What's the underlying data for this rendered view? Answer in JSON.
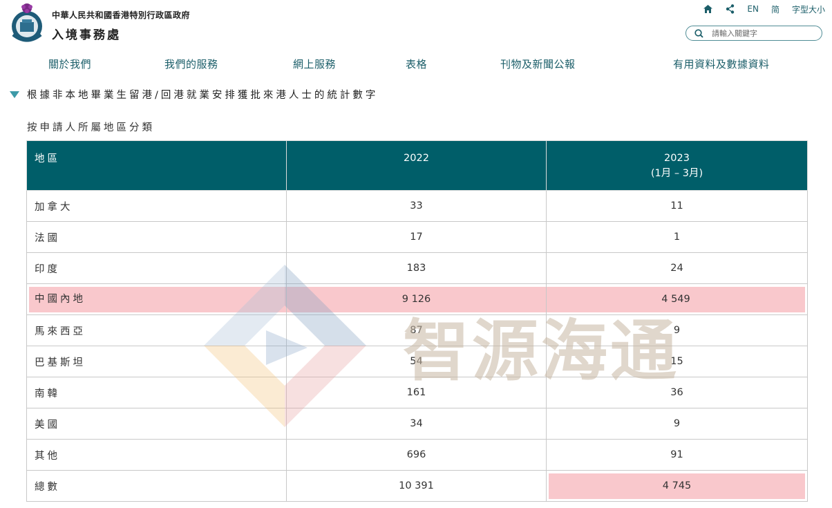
{
  "header": {
    "gov_name": "中華人民共和國香港特別行政區政府",
    "dept_name": "入境事務處",
    "lang_en": "EN",
    "lang_sc": "简",
    "font_size": "字型大小",
    "search_placeholder": "請輸入關鍵字"
  },
  "nav": [
    {
      "label": "關於我們"
    },
    {
      "label": "我們的服務"
    },
    {
      "label": "網上服務"
    },
    {
      "label": "表格"
    },
    {
      "label": "刊物及新聞公報"
    },
    {
      "label": "有用資料及數據資料"
    }
  ],
  "section": {
    "title": "根據非本地畢業生留港/回港就業安排獲批來港人士的統計數字",
    "subtitle": "按申請人所屬地區分類"
  },
  "table": {
    "headers": {
      "region": "地區",
      "y2022": "2022",
      "y2023": "2023",
      "y2023_note": "(1月 – 3月)"
    },
    "rows": [
      {
        "region": "加拿大",
        "y2022": "33",
        "y2023": "11"
      },
      {
        "region": "法國",
        "y2022": "17",
        "y2023": "1"
      },
      {
        "region": "印度",
        "y2022": "183",
        "y2023": "24"
      },
      {
        "region": "中國內地",
        "y2022": "9 126",
        "y2023": "4 549"
      },
      {
        "region": "馬來西亞",
        "y2022": "87",
        "y2023": "9"
      },
      {
        "region": "巴基斯坦",
        "y2022": "54",
        "y2023": "15"
      },
      {
        "region": "南韓",
        "y2022": "161",
        "y2023": "36"
      },
      {
        "region": "美國",
        "y2022": "34",
        "y2023": "9"
      },
      {
        "region": "其他",
        "y2022": "696",
        "y2023": "91"
      },
      {
        "region": "總數",
        "y2022": "10 391",
        "y2023": "4 745"
      }
    ]
  },
  "watermark": {
    "text": "智源海通"
  },
  "colors": {
    "brand": "#005e69",
    "link": "#1b5e69",
    "accent": "#3d9aa8",
    "highlight": "#f9c8cc"
  }
}
